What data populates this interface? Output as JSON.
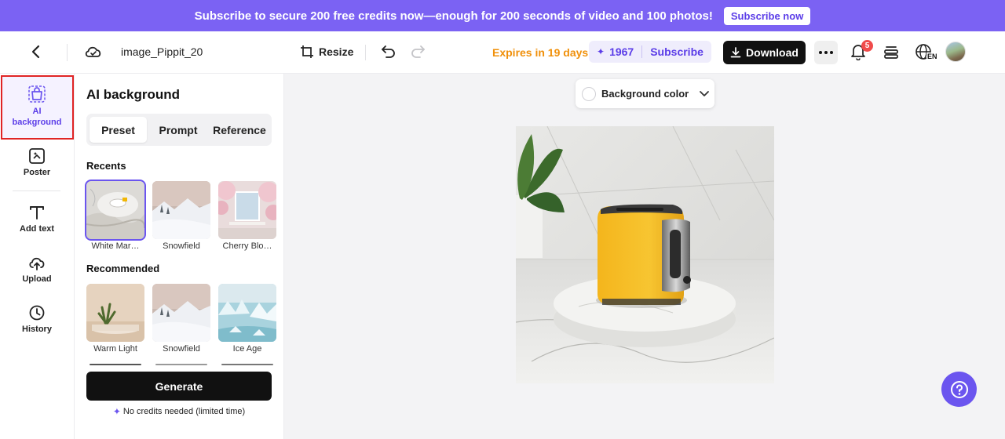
{
  "promo": {
    "text": "Subscribe to secure 200 free credits now—enough for 200 seconds of video and 100 photos!",
    "button": "Subscribe now"
  },
  "header": {
    "file_name": "image_Pippit_20",
    "resize_label": "Resize",
    "expires": "Expires in 19 days",
    "credits": "1967",
    "subscribe": "Subscribe",
    "download": "Download",
    "notification_count": "5",
    "language_code": "EN"
  },
  "rail": {
    "items": [
      {
        "label": "AI background",
        "icon": "bag-frame-icon"
      },
      {
        "label": "Poster",
        "icon": "poster-icon"
      },
      {
        "label": "Add text",
        "icon": "text-icon"
      },
      {
        "label": "Upload",
        "icon": "cloud-upload-icon"
      },
      {
        "label": "History",
        "icon": "clock-icon"
      }
    ]
  },
  "panel": {
    "title": "AI background",
    "tabs": [
      "Preset",
      "Prompt",
      "Reference"
    ],
    "recents_title": "Recents",
    "recents": [
      {
        "label": "White Mar…"
      },
      {
        "label": "Snowfield"
      },
      {
        "label": "Cherry Blo…"
      }
    ],
    "recommended_title": "Recommended",
    "recommended": [
      {
        "label": "Warm Light"
      },
      {
        "label": "Snowfield"
      },
      {
        "label": "Ice Age"
      }
    ],
    "generate": "Generate",
    "credits_note": "No credits needed (limited time)"
  },
  "canvas": {
    "background_color_label": "Background color"
  },
  "colors": {
    "accent": "#6b55ef",
    "promo": "#7b62f3",
    "expires": "#f0900a",
    "highlight": "#e02424"
  }
}
